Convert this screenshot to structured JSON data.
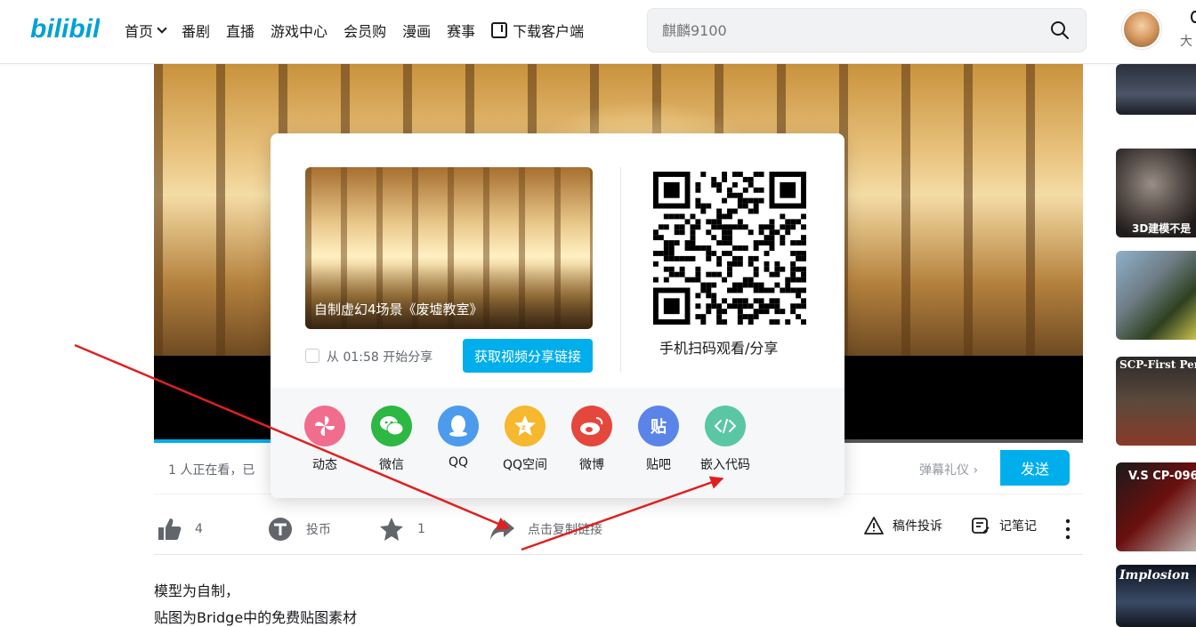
{
  "header": {
    "logo_text": "bilibili",
    "nav": [
      {
        "label": "首页",
        "has_dropdown": true
      },
      {
        "label": "番剧"
      },
      {
        "label": "直播"
      },
      {
        "label": "游戏中心"
      },
      {
        "label": "会员购"
      },
      {
        "label": "漫画"
      },
      {
        "label": "赛事"
      },
      {
        "label": "下载客户端",
        "icon": "download-icon"
      }
    ],
    "search_placeholder": "麒麟9100",
    "user_partial": "大"
  },
  "player": {
    "viewer_text": "1 人正在看，已",
    "danmaku_etiquette": "弹幕礼仪 ›",
    "send_label": "发送",
    "progress_fraction": 0.13
  },
  "share_panel": {
    "video_title": "自制虚幻4场景《废墟教室》",
    "start_from_label": "从 01:58 开始分享",
    "get_link_label": "获取视频分享链接",
    "qr_caption": "手机扫码观看/分享",
    "platforms": [
      {
        "label": "动态",
        "icon": "pinwheel-icon",
        "color": "#f06d8e"
      },
      {
        "label": "微信",
        "icon": "wechat-icon",
        "color": "#2db743"
      },
      {
        "label": "QQ",
        "icon": "qq-icon",
        "color": "#4d9bed"
      },
      {
        "label": "QQ空间",
        "icon": "qzone-icon",
        "color": "#f5b82e"
      },
      {
        "label": "微博",
        "icon": "weibo-icon",
        "color": "#e5473d"
      },
      {
        "label": "贴吧",
        "icon": "tieba-icon",
        "color": "#5a84e8"
      },
      {
        "label": "嵌入代码",
        "icon": "embed-code-icon",
        "color": "#5bc6a4"
      }
    ]
  },
  "toolbar": {
    "like_count": "4",
    "coin_label": "投币",
    "favorite_count": "1",
    "share_label": "点击复制链接",
    "report_label": "稿件投诉",
    "note_label": "记笔记"
  },
  "description": {
    "line1": "模型为自制，",
    "line2": "贴图为Bridge中的免费贴图素材"
  },
  "sidebar": {
    "items": [
      {
        "caption": ""
      },
      {
        "caption": "3D建模不是"
      },
      {
        "caption": ""
      },
      {
        "caption": "SCP-First Pers"
      },
      {
        "caption": "V.S CP-096"
      },
      {
        "caption": "Implosion"
      }
    ]
  },
  "colors": {
    "accent": "#00aeec",
    "annotation_arrow": "#e02020"
  }
}
